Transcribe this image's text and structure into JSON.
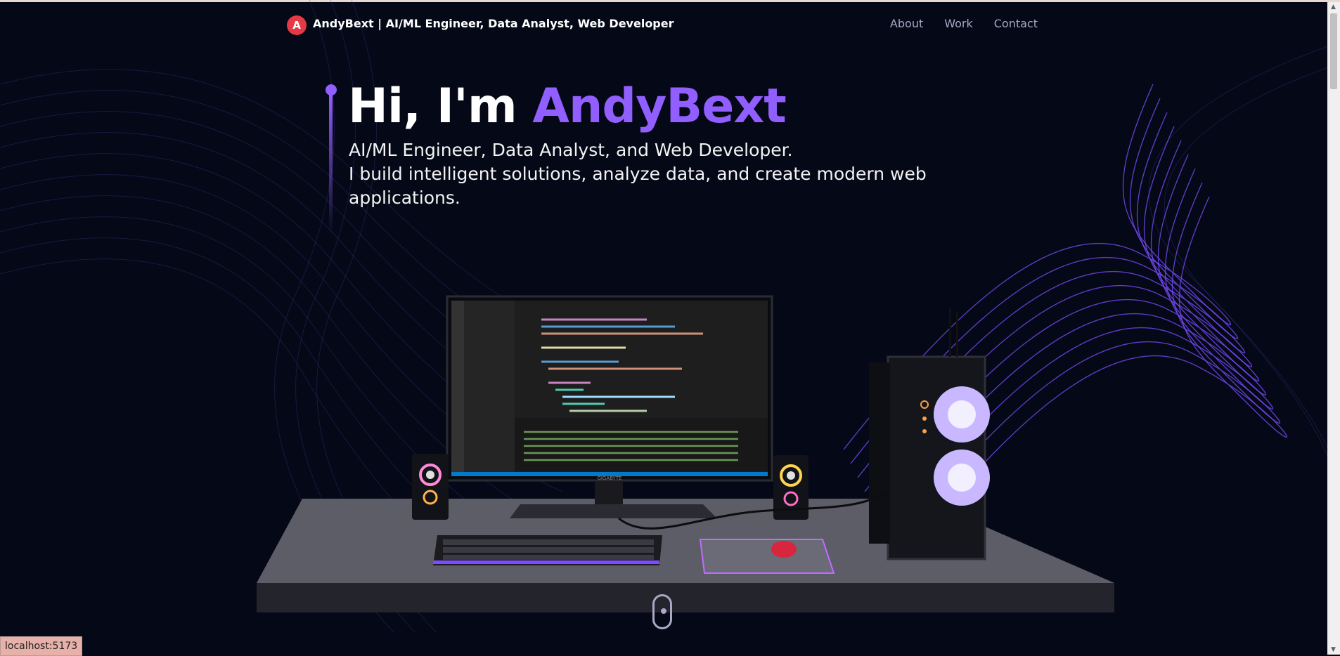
{
  "navbar": {
    "logo_letter": "A",
    "brand": "AndyBext | AI/ML Engineer, Data Analyst, Web Developer",
    "links": [
      "About",
      "Work",
      "Contact"
    ]
  },
  "hero": {
    "title_prefix": "Hi, I'm ",
    "title_name": "AndyBext",
    "subtitle_line1": "AI/ML Engineer, Data Analyst, and Web Developer.",
    "subtitle_line2": "I build intelligent solutions, analyze data, and create modern web applications."
  },
  "scene": {
    "monitor_brand": "GIGABYTE"
  },
  "status_bar": {
    "url": "localhost:5173"
  },
  "colors": {
    "background": "#050816",
    "accent": "#915eff",
    "nav_link": "#aaa6c3",
    "logo": "#e63946"
  }
}
